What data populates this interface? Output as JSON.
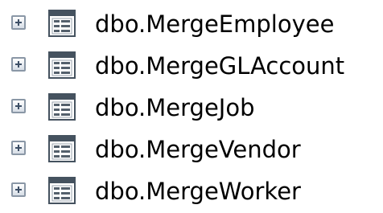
{
  "tree": {
    "nodes": [
      {
        "label": "dbo.MergeEmployee",
        "icon": "table-icon",
        "expander": "plus"
      },
      {
        "label": "dbo.MergeGLAccount",
        "icon": "table-icon",
        "expander": "plus"
      },
      {
        "label": "dbo.MergeJob",
        "icon": "table-icon",
        "expander": "plus"
      },
      {
        "label": "dbo.MergeVendor",
        "icon": "table-icon",
        "expander": "plus"
      },
      {
        "label": "dbo.MergeWorker",
        "icon": "table-icon",
        "expander": "plus"
      }
    ]
  },
  "colors": {
    "text": "#000000",
    "icon_border": "#45525f",
    "expander_border": "#8a97a6"
  }
}
